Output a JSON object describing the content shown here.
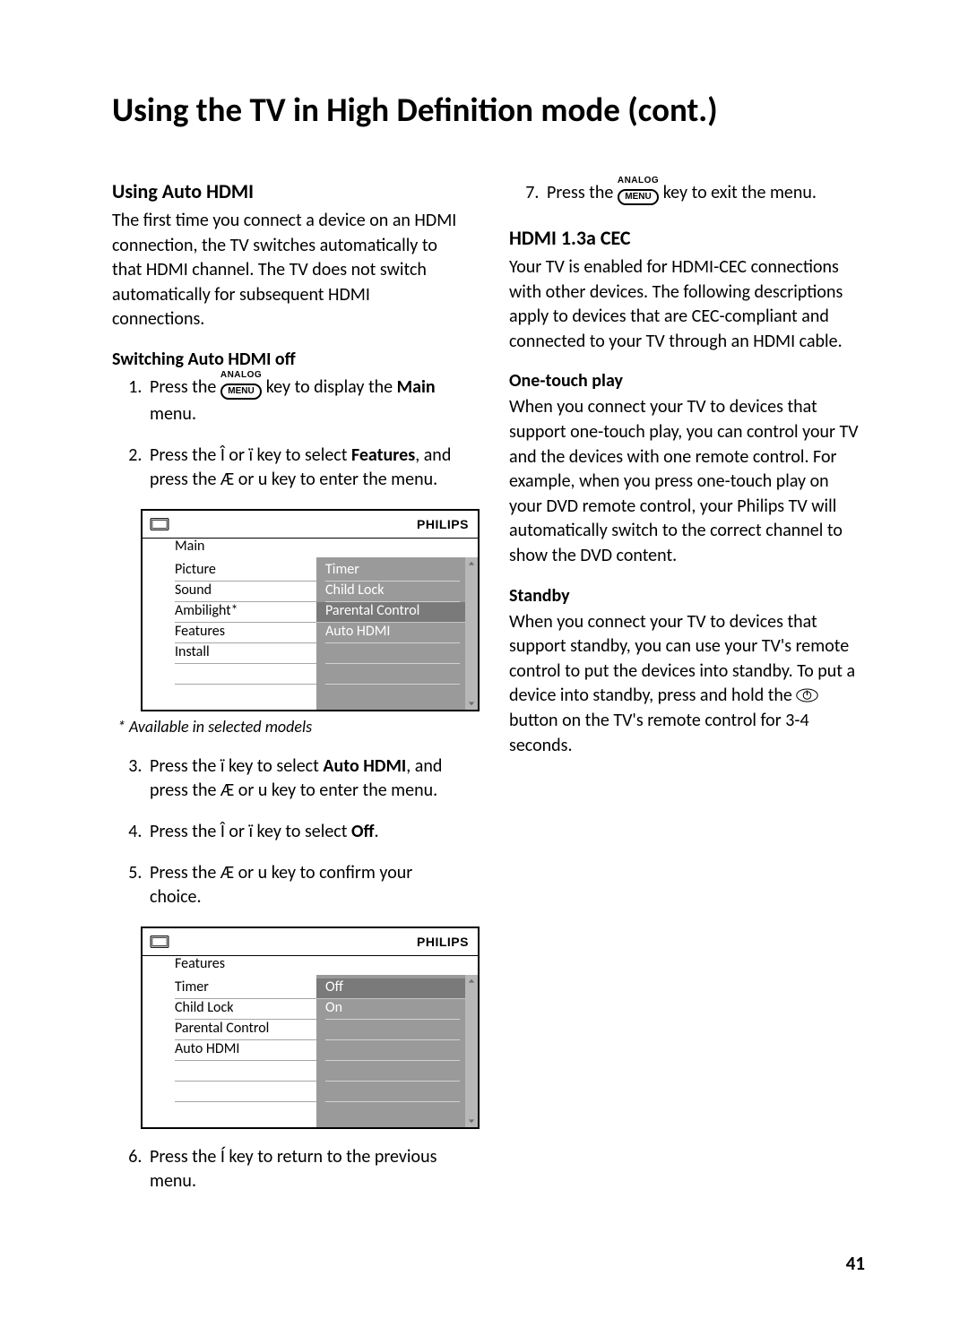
{
  "page": {
    "title": "Using the TV in High Definition mode (cont.)",
    "number": "41"
  },
  "menu_key": {
    "top": "ANALOG",
    "label": "MENU"
  },
  "left": {
    "h_auto_hdmi": "Using Auto HDMI",
    "p_intro": "The first time you connect a device on an HDMI connection, the TV switches automatically to that HDMI channel. The TV does not switch automatically for subsequent HDMI connections.",
    "h_switch_off": "Switching Auto HDMI off",
    "step1_a": "Press the ",
    "step1_b": " key to display the ",
    "step1_main": "Main",
    "step1_c": " menu.",
    "step2_a": "Press the Î or ï key to select ",
    "step2_features": "Features",
    "step2_b": ", and press the Æ or u key to enter the menu.",
    "footnote": "* Available in selected models",
    "step3_a": "Press the ï key to select ",
    "step3_auto": "Auto HDMI",
    "step3_b": ", and press the Æ or u key to enter the menu.",
    "step4_a": "Press the Î or ï key to select ",
    "step4_off": "Off",
    "step4_b": ".",
    "step5": "Press the Æ or u key to confirm your choice.",
    "step6": "Press the Í key to return to the previous menu."
  },
  "right": {
    "step7_a": "Press the ",
    "step7_b": " key to exit the menu.",
    "h_cec": "HDMI 1.3a CEC",
    "p_cec": "Your TV is enabled for HDMI-CEC connections with other devices. The following descriptions apply to devices that are CEC-compliant and connected to your TV through an HDMI cable.",
    "h_onetouch": "One-touch play",
    "p_onetouch": "When you connect your TV to devices that support one-touch play, you can control your TV and the devices with one remote control. For example, when you press one-touch play on your DVD remote control, your Philips TV will automatically switch to the correct channel to show the DVD content.",
    "h_standby": "Standby",
    "standby_a": "When you connect your TV to devices that support standby, you can use your TV's remote control to put the devices into standby. To put a device into standby, press and hold the ",
    "standby_b": " button on the TV's remote control for 3-4 seconds."
  },
  "osd_brand": "PHILIPS",
  "osd1": {
    "title": "Main",
    "left": [
      "Picture",
      "Sound",
      "Ambilight*",
      "Features",
      "Install"
    ],
    "right": [
      "Timer",
      "Child Lock",
      "Parental Control",
      "Auto HDMI"
    ]
  },
  "osd2": {
    "title": "Features",
    "left": [
      "Timer",
      "Child Lock",
      "Parental Control",
      "Auto HDMI"
    ],
    "right": [
      "Off",
      "On"
    ]
  }
}
